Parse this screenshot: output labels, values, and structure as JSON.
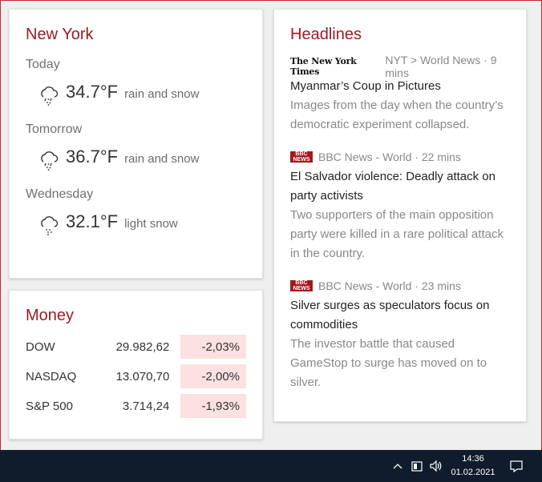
{
  "weather": {
    "city": "New York",
    "days": [
      {
        "label": "Today",
        "temp": "34.7°F",
        "condition": "rain and snow",
        "icon": "rain-snow-icon"
      },
      {
        "label": "Tomorrow",
        "temp": "36.7°F",
        "condition": "rain and snow",
        "icon": "rain-snow-icon"
      },
      {
        "label": "Wednesday",
        "temp": "32.1°F",
        "condition": "light snow",
        "icon": "light-snow-icon"
      }
    ]
  },
  "money": {
    "title": "Money",
    "stocks": [
      {
        "name": "DOW",
        "value": "29.982,62",
        "change": "-2,03%"
      },
      {
        "name": "NASDAQ",
        "value": "13.070,70",
        "change": "-2,00%"
      },
      {
        "name": "S&P 500",
        "value": "3.714,24",
        "change": "-1,93%"
      }
    ]
  },
  "headlines": {
    "title": "Headlines",
    "items": [
      {
        "logo": "The New York Times",
        "source": "NYT > World News · 9 mins",
        "title": "Myanmar’s Coup in Pictures",
        "desc": "Images from the day when the country’s democratic experiment collapsed."
      },
      {
        "logo": "BBC NEWS",
        "source": "BBC News - World · 22 mins",
        "title": "El Salvador violence: Deadly attack on party activists",
        "desc": "Two supporters of the main opposition party were killed in a rare political attack in the country."
      },
      {
        "logo": "BBC NEWS",
        "source": "BBC News - World · 23 mins",
        "title": "Silver surges as speculators focus on commodities",
        "desc": "The investor battle that caused GameStop to surge has moved on to silver."
      }
    ]
  },
  "taskbar": {
    "time": "14:36",
    "date": "01.02.2021"
  },
  "colors": {
    "accent": "#9b1c22",
    "taskbar": "#101c2c",
    "negative_bg": "#fde0e0"
  }
}
